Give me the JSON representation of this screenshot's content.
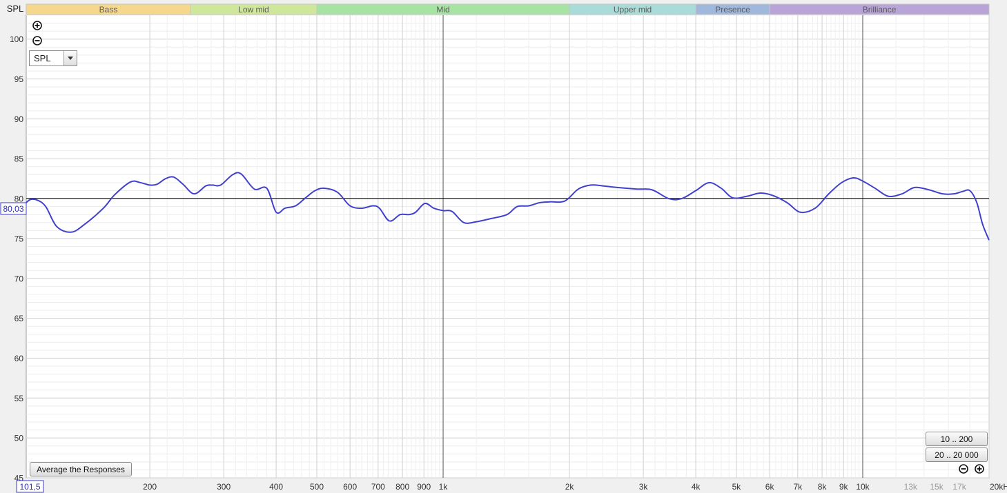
{
  "axis": {
    "y_title": "SPL",
    "y_ticks": [
      "100",
      "95",
      "90",
      "85",
      "80",
      "75",
      "70",
      "65",
      "60",
      "55",
      "50",
      "45"
    ],
    "x_ticks": [
      "200",
      "300",
      "400",
      "500",
      "600",
      "700",
      "800",
      "900",
      "1k",
      "2k",
      "3k",
      "4k",
      "5k",
      "6k",
      "7k",
      "8k",
      "9k",
      "10k",
      "13k",
      "15k",
      "17k",
      "20kHz"
    ],
    "cursor_y_readout": "80,03",
    "cursor_x_readout": "101,5"
  },
  "bands": [
    {
      "label": "Bass",
      "from": 101.5,
      "to": 250,
      "color": "#f5d88c"
    },
    {
      "label": "Low mid",
      "from": 250,
      "to": 500,
      "color": "#cfe79a"
    },
    {
      "label": "Mid",
      "from": 500,
      "to": 2000,
      "color": "#a7e3a3"
    },
    {
      "label": "Upper mid",
      "from": 2000,
      "to": 4000,
      "color": "#a9dcd8"
    },
    {
      "label": "Presence",
      "from": 4000,
      "to": 6000,
      "color": "#9fb8dc"
    },
    {
      "label": "Brilliance",
      "from": 6000,
      "to": 20000,
      "color": "#b8a4d6"
    }
  ],
  "controls": {
    "measurement_select": "SPL",
    "range_button_1": "10 .. 200",
    "range_button_2": "20 .. 20 000",
    "average_button": "Average the Responses"
  },
  "chart_data": {
    "type": "line",
    "title": "",
    "xlabel": "",
    "ylabel": "SPL",
    "x_scale": "log",
    "xlim": [
      101.5,
      20000
    ],
    "ylim": [
      45,
      103
    ],
    "grid": true,
    "reference_line_y": 80.03,
    "series": [
      {
        "color": "#4040cc",
        "x": [
          101.5,
          104,
          108,
          113,
          120,
          130,
          140,
          155,
          165,
          180,
          190,
          200,
          208,
          218,
          228,
          240,
          255,
          272,
          282,
          295,
          315,
          330,
          355,
          380,
          400,
          420,
          445,
          470,
          495,
          520,
          560,
          600,
          640,
          680,
          705,
          745,
          790,
          830,
          860,
          905,
          950,
          1000,
          1050,
          1120,
          1200,
          1300,
          1420,
          1500,
          1600,
          1700,
          1800,
          1950,
          2100,
          2250,
          2400,
          2600,
          2900,
          3150,
          3450,
          3700,
          4000,
          4300,
          4600,
          4900,
          5300,
          5700,
          6100,
          6600,
          7100,
          7700,
          8300,
          8900,
          9500,
          10000,
          10700,
          11500,
          12400,
          13300,
          14400,
          15500,
          16500,
          17300,
          18000,
          18700,
          19300,
          20000
        ],
        "y": [
          79.5,
          79.9,
          79.8,
          79,
          76.5,
          75.8,
          76.8,
          78.8,
          80.5,
          82.1,
          82,
          81.7,
          81.8,
          82.5,
          82.7,
          81.8,
          80.6,
          81.6,
          81.7,
          81.7,
          83,
          83.1,
          81.2,
          81.3,
          78.3,
          78.8,
          79.1,
          80.1,
          81,
          81.3,
          80.8,
          79.1,
          78.8,
          79.1,
          78.8,
          77.2,
          78,
          78,
          78.3,
          79.4,
          78.8,
          78.5,
          78.4,
          77,
          77.1,
          77.5,
          78,
          79,
          79.1,
          79.5,
          79.6,
          79.7,
          81.2,
          81.7,
          81.6,
          81.4,
          81.2,
          81.1,
          80,
          80,
          81,
          82,
          81.3,
          80.1,
          80.3,
          80.7,
          80.4,
          79.5,
          78.3,
          78.8,
          80.6,
          82,
          82.6,
          82.2,
          81.3,
          80.3,
          80.6,
          81.4,
          81.1,
          80.6,
          80.6,
          80.9,
          81,
          79.5,
          76.8,
          74.8
        ]
      }
    ]
  }
}
